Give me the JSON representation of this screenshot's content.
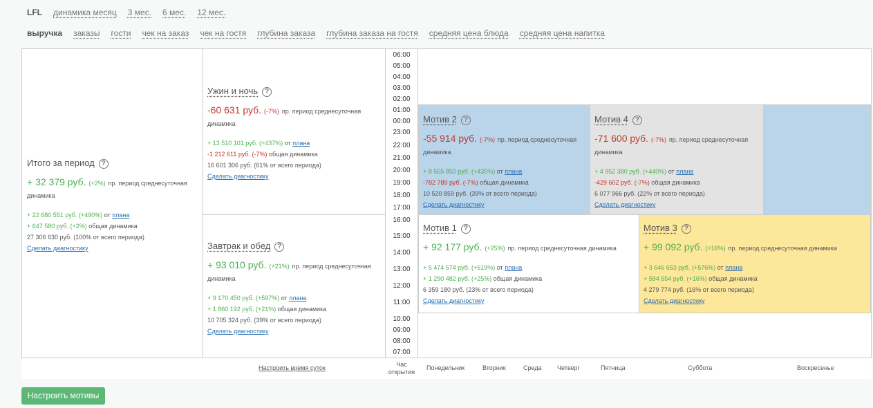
{
  "nav_periods": [
    "LFL",
    "динамика месяц",
    "3 мес.",
    "6 мес.",
    "12 мес."
  ],
  "nav_metrics": [
    "выручка",
    "заказы",
    "гости",
    "чек на заказ",
    "чек на гостя",
    "глубина заказа",
    "глубина заказа на гостя",
    "средняя цена блюда",
    "средняя цена напитка"
  ],
  "total": {
    "title": "Итого за период",
    "value": "+ 32 379 руб.",
    "pct": "(+2%)",
    "desc": "пр. период среднесуточная динамика",
    "plan_line": "+ 22 680 551 руб. (+490%)",
    "plan_text": "от",
    "plan_link": "плана",
    "general_line": "+ 647 580 руб. (+2%)",
    "general_text": "общая динамика",
    "sum_line": "27 306 630 руб. (100% от всего периода)",
    "diag": "Сделать диагностику"
  },
  "dinner": {
    "title": "Ужин и ночь",
    "value": "-60 631 руб.",
    "pct": "(-7%)",
    "desc": "пр. период среднесуточная динамика",
    "plan_line": "+ 13 510 101 руб. (+437%)",
    "plan_text": "от",
    "plan_link": "плана",
    "general_line": "-1 212 611 руб. (-7%)",
    "general_text": "общая динамика",
    "sum_line": "16 601 306 руб. (61% от всего периода)",
    "diag": "Сделать диагностику"
  },
  "breakfast": {
    "title": "Завтрак и обед",
    "value": "+ 93 010 руб.",
    "pct": "(+21%)",
    "desc": "пр. период среднесуточная динамика",
    "plan_line": "+ 9 170 450 руб. (+597%)",
    "plan_text": "от",
    "plan_link": "плана",
    "general_line": "+ 1 860 192 руб. (+21%)",
    "general_text": "общая динамика",
    "sum_line": "10 705 324 руб. (39% от всего периода)",
    "diag": "Сделать диагностику"
  },
  "times": [
    "06:00",
    "05:00",
    "04:00",
    "03:00",
    "02:00",
    "01:00",
    "00:00",
    "23:00",
    "22:00",
    "21:00",
    "20:00",
    "19:00",
    "18:00",
    "17:00",
    "16:00",
    "15:00",
    "14:00",
    "13:00",
    "12:00",
    "11:00",
    "10:00",
    "09:00",
    "08:00",
    "07:00"
  ],
  "motiv2": {
    "title": "Мотив 2",
    "value": "-55 914 руб.",
    "pct": "(-7%)",
    "desc": "пр. период среднесуточная динамика",
    "plan_line": "+ 8 555 850 руб. (+435%)",
    "plan_text": "от",
    "plan_link": "плана",
    "general_line": "-782 789 руб. (-7%)",
    "general_text": "общая динамика",
    "sum_line": "10 520 859 руб. (39% от всего периода)",
    "diag": "Сделать диагностику",
    "color": "#bad4ea"
  },
  "motiv4": {
    "title": "Мотив 4",
    "value": "-71 600 руб.",
    "pct": "(-7%)",
    "desc": "пр. период среднесуточная динамика",
    "plan_line": "+ 4 952 380 руб. (+440%)",
    "plan_text": "от",
    "plan_link": "плана",
    "general_line": "-429 602 руб. (-7%)",
    "general_text": "общая динамика",
    "sum_line": "6 077 966 руб. (22% от всего периода)",
    "diag": "Сделать диагностику",
    "color": "#e3e3e3"
  },
  "motiv1": {
    "title": "Мотив 1",
    "value": "+ 92 177 руб.",
    "pct": "(+25%)",
    "desc": "пр. период среднесуточная динамика",
    "plan_line": "+ 5 474 574 руб. (+619%)",
    "plan_text": "от",
    "plan_link": "плана",
    "general_line": "+ 1 290 482 руб. (+25%)",
    "general_text": "общая динамика",
    "sum_line": "6 359 180 руб. (23% от всего периода)",
    "diag": "Сделать диагностику",
    "color": "#ffffff"
  },
  "motiv3": {
    "title": "Мотив 3",
    "value": "+ 99 092 руб.",
    "pct": "(+16%)",
    "desc": "пр. период среднесуточная динамика",
    "plan_line": "+ 3 646 653 руб. (+576%)",
    "plan_text": "от",
    "plan_link": "плана",
    "general_line": "+ 594 554 руб. (+16%)",
    "general_text": "общая динамика",
    "sum_line": "4 279 774 руб. (16% от всего периода)",
    "diag": "Сделать диагностику",
    "color": "#fde79b"
  },
  "footer": {
    "configure_time": "Настроить время суток",
    "open_hour": "Час открытия",
    "days": [
      "Понедельник",
      "Вторник",
      "Среда",
      "Четверг",
      "Пятница",
      "Суббота",
      "Воскресенье"
    ]
  },
  "button_label": "Настроить мотивы",
  "colors": {
    "positive": "#4caf50",
    "negative": "#c0392b",
    "button": "#5cb877",
    "link": "#2a6fb0"
  }
}
